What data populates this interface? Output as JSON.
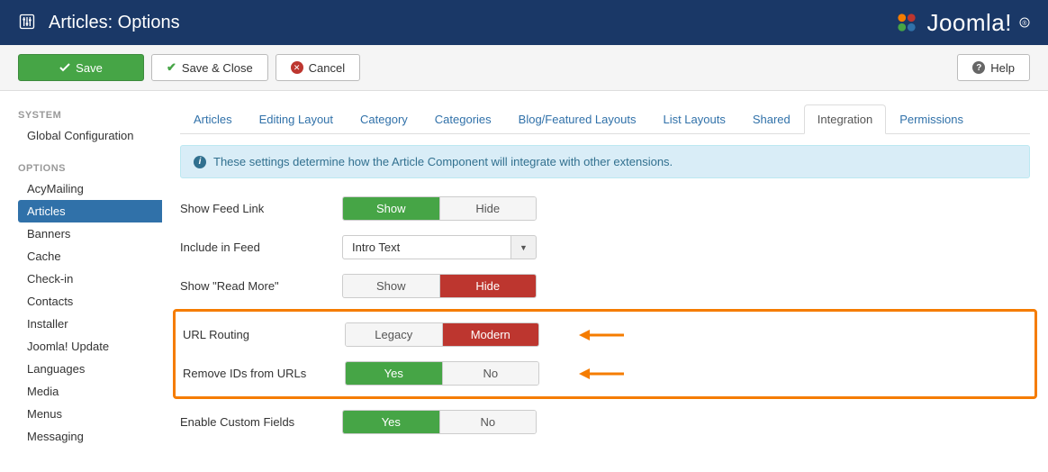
{
  "header": {
    "title": "Articles: Options",
    "brand": "Joomla!"
  },
  "toolbar": {
    "save": "Save",
    "save_close": "Save & Close",
    "cancel": "Cancel",
    "help": "Help"
  },
  "sidebar": {
    "system_head": "SYSTEM",
    "global_config": "Global Configuration",
    "options_head": "OPTIONS",
    "items": [
      "AcyMailing",
      "Articles",
      "Banners",
      "Cache",
      "Check-in",
      "Contacts",
      "Installer",
      "Joomla! Update",
      "Languages",
      "Media",
      "Menus",
      "Messaging"
    ],
    "active_index": 1
  },
  "tabs": {
    "items": [
      "Articles",
      "Editing Layout",
      "Category",
      "Categories",
      "Blog/Featured Layouts",
      "List Layouts",
      "Shared",
      "Integration",
      "Permissions"
    ],
    "active_index": 7
  },
  "info_text": "These settings determine how the Article Component will integrate with other extensions.",
  "fields": {
    "feed_link": {
      "label": "Show Feed Link",
      "opt1": "Show",
      "opt2": "Hide"
    },
    "include_feed": {
      "label": "Include in Feed",
      "value": "Intro Text"
    },
    "read_more": {
      "label": "Show \"Read More\"",
      "opt1": "Show",
      "opt2": "Hide"
    },
    "url_routing": {
      "label": "URL Routing",
      "opt1": "Legacy",
      "opt2": "Modern"
    },
    "remove_ids": {
      "label": "Remove IDs from URLs",
      "opt1": "Yes",
      "opt2": "No"
    },
    "custom_fields": {
      "label": "Enable Custom Fields",
      "opt1": "Yes",
      "opt2": "No"
    }
  }
}
